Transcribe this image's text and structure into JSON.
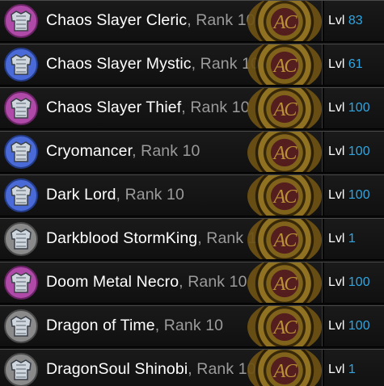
{
  "characters": [
    {
      "name": "Chaos Slayer Cleric",
      "rank": ", Rank 10",
      "lvl_label": "Lvl",
      "level": "83",
      "icon": "cleric-armor-icon",
      "accent": "#b04aa8"
    },
    {
      "name": "Chaos Slayer Mystic",
      "rank": ", Rank 10",
      "lvl_label": "Lvl",
      "level": "61",
      "icon": "mystic-armor-icon",
      "accent": "#4a6ad8"
    },
    {
      "name": "Chaos Slayer Thief",
      "rank": ", Rank 10",
      "lvl_label": "Lvl",
      "level": "100",
      "icon": "thief-armor-icon",
      "accent": "#b04aa8"
    },
    {
      "name": "Cryomancer",
      "rank": ", Rank 10",
      "lvl_label": "Lvl",
      "level": "100",
      "icon": "cryomancer-armor-icon",
      "accent": "#4a6ad8"
    },
    {
      "name": "Dark Lord",
      "rank": ", Rank 10",
      "lvl_label": "Lvl",
      "level": "100",
      "icon": "dark-lord-armor-icon",
      "accent": "#4a6ad8"
    },
    {
      "name": "Darkblood StormKing",
      "rank": ", Rank 1",
      "lvl_label": "Lvl",
      "level": "1",
      "icon": "stormking-armor-icon",
      "accent": "#8a8a8a"
    },
    {
      "name": "Doom Metal Necro",
      "rank": ", Rank 10",
      "lvl_label": "Lvl",
      "level": "100",
      "icon": "necro-armor-icon",
      "accent": "#b04aa8"
    },
    {
      "name": "Dragon of Time",
      "rank": ", Rank 10",
      "lvl_label": "Lvl",
      "level": "100",
      "icon": "dragon-of-time-armor-icon",
      "accent": "#8a8a8a"
    },
    {
      "name": "DragonSoul Shinobi",
      "rank": ", Rank 10",
      "lvl_label": "Lvl",
      "level": "1",
      "icon": "shinobi-armor-icon",
      "accent": "#8a8a8a"
    }
  ],
  "badge_text": "AC",
  "colors": {
    "level_value": "#2fa6e2",
    "rank_text": "#9b9b9b",
    "name_text": "#ffffff"
  }
}
